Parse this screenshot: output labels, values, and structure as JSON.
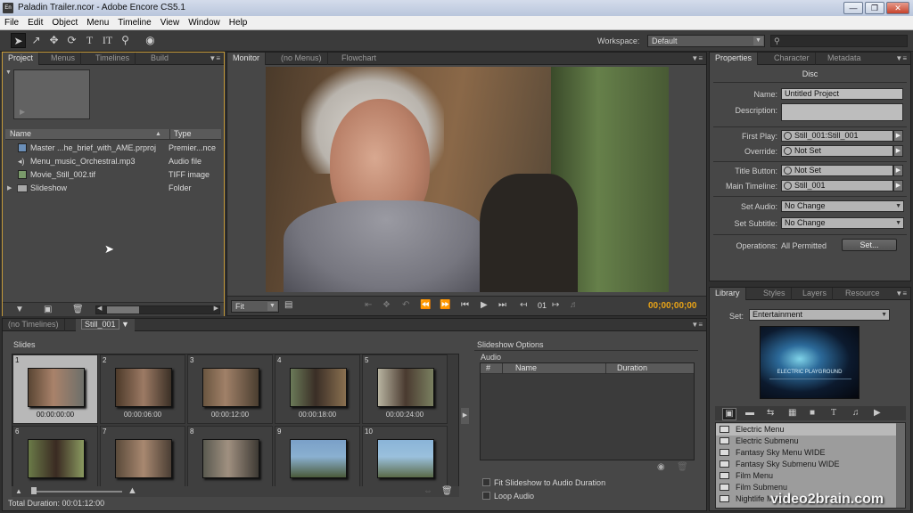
{
  "window": {
    "title": "Paladin Trailer.ncor - Adobe Encore CS5.1",
    "app_icon": "En"
  },
  "menu": [
    "File",
    "Edit",
    "Object",
    "Menu",
    "Timeline",
    "View",
    "Window",
    "Help"
  ],
  "toolbar": {
    "workspace_label": "Workspace:",
    "workspace_value": "Default",
    "tool_icons": [
      "selection-arrow-icon",
      "direct-select-icon",
      "move-icon",
      "rotate-icon",
      "text-icon",
      "vertical-text-icon",
      "zoom-icon",
      "preview-icon"
    ]
  },
  "project_panel": {
    "tabs": [
      "Project",
      "Menus",
      "Timelines",
      "Build"
    ],
    "columns": {
      "name": "Name",
      "type": "Type"
    },
    "items": [
      {
        "name": "Master ...he_brief_with_AME.prproj",
        "type": "Premier...nce",
        "icon": "premiere-file-icon"
      },
      {
        "name": "Menu_music_Orchestral.mp3",
        "type": "Audio file",
        "icon": "audio-file-icon"
      },
      {
        "name": "Movie_Still_002.tif",
        "type": "TIFF image",
        "icon": "image-file-icon"
      },
      {
        "name": "Slideshow",
        "type": "Folder",
        "icon": "folder-icon"
      }
    ]
  },
  "monitor_panel": {
    "tabs": [
      "Monitor",
      "(no Menus)",
      "Flowchart"
    ],
    "fit_value": "Fit",
    "chapter": "01",
    "timecode": "00;00;00;00",
    "timecode_color": "#e8a317"
  },
  "properties_panel": {
    "tabs": [
      "Properties",
      "Character",
      "Metadata"
    ],
    "heading": "Disc",
    "name_label": "Name:",
    "name_value": "Untitled Project",
    "description_label": "Description:",
    "first_play_label": "First Play:",
    "first_play_value": "Still_001:Still_001",
    "override_label": "Override:",
    "override_value": "Not Set",
    "title_button_label": "Title Button:",
    "title_button_value": "Not Set",
    "main_timeline_label": "Main Timeline:",
    "main_timeline_value": "Still_001",
    "set_audio_label": "Set Audio:",
    "set_audio_value": "No Change",
    "set_subtitle_label": "Set Subtitle:",
    "set_subtitle_value": "No Change",
    "operations_label": "Operations:",
    "operations_value": "All Permitted",
    "set_button": "Set..."
  },
  "library_panel": {
    "tabs": [
      "Library",
      "Styles",
      "Layers",
      "Resource"
    ],
    "set_label": "Set:",
    "set_value": "Entertainment",
    "preview_text": "ELECTRIC PLAYGROUND",
    "items": [
      "Electric Menu",
      "Electric Submenu",
      "Fantasy Sky Menu WIDE",
      "Fantasy Sky Submenu WIDE",
      "Film Menu",
      "Film Submenu",
      "Nightlife Menu"
    ]
  },
  "slideshow_panel": {
    "tabs": [
      "(no Timelines)",
      "Still_001"
    ],
    "slides_label": "Slides",
    "slides": [
      {
        "n": "1",
        "tc": "00:00:00:00"
      },
      {
        "n": "2",
        "tc": "00:00:06:00"
      },
      {
        "n": "3",
        "tc": "00:00:12:00"
      },
      {
        "n": "4",
        "tc": "00:00:18:00"
      },
      {
        "n": "5",
        "tc": "00:00:24:00"
      },
      {
        "n": "6",
        "tc": ""
      },
      {
        "n": "7",
        "tc": ""
      },
      {
        "n": "8",
        "tc": ""
      },
      {
        "n": "9",
        "tc": ""
      },
      {
        "n": "10",
        "tc": ""
      }
    ],
    "options_label": "Slideshow Options",
    "audio_label": "Audio",
    "audio_columns": {
      "num": "#",
      "name": "Name",
      "duration": "Duration"
    },
    "fit_checkbox": "Fit Slideshow to Audio Duration",
    "loop_checkbox": "Loop Audio",
    "total_duration": "Total Duration: 00:01:12:00"
  },
  "watermark": "video2brain.com"
}
